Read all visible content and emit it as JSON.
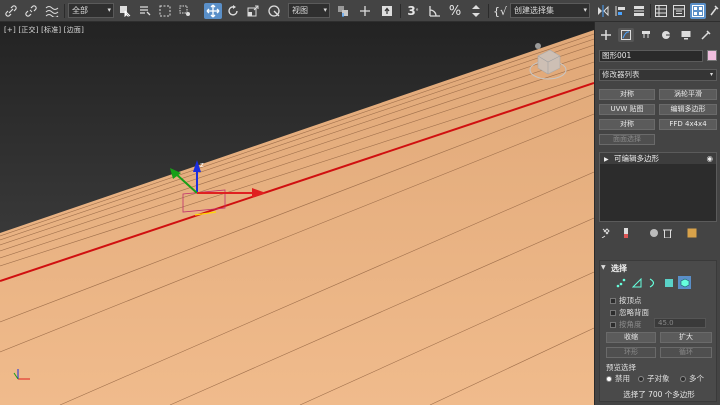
{
  "toolbar": {
    "filter_value": "全部",
    "viewport_ref": "视图",
    "selection_set": "创建选择集"
  },
  "viewport": {
    "label_plus": "[+]",
    "label_view": "[正交]",
    "label_shading": "[标准]",
    "label_edges": "[边面]"
  },
  "panel": {
    "object_name": "图形001",
    "object_color": "#f2bfe0",
    "modifier_list": "修改器列表",
    "buttons": {
      "symmetry": "对称",
      "turbosmooth": "涡轮平滑",
      "uvw_map": "UVW 贴图",
      "edit_poly": "编辑多边形",
      "symmetry2": "对称",
      "ffd": "FFD 4x4x4",
      "surface_select": "面面选择"
    },
    "stack_item": "可编辑多边形",
    "selection": {
      "title": "选择",
      "by_vertex": "按顶点",
      "ignore_backface": "忽略背面",
      "by_angle": "按角度",
      "angle_value": "45.0",
      "shrink": "收缩",
      "grow": "扩大",
      "ring": "环形",
      "loop": "循环",
      "preview_label": "预览选择",
      "off": "禁用",
      "subobject": "子对象",
      "multi": "多个",
      "status": "选择了 700 个多边形"
    }
  },
  "colors": {
    "accent": "#5a8fc8",
    "surface": "#e8b080",
    "red_axis": "#d01010"
  }
}
